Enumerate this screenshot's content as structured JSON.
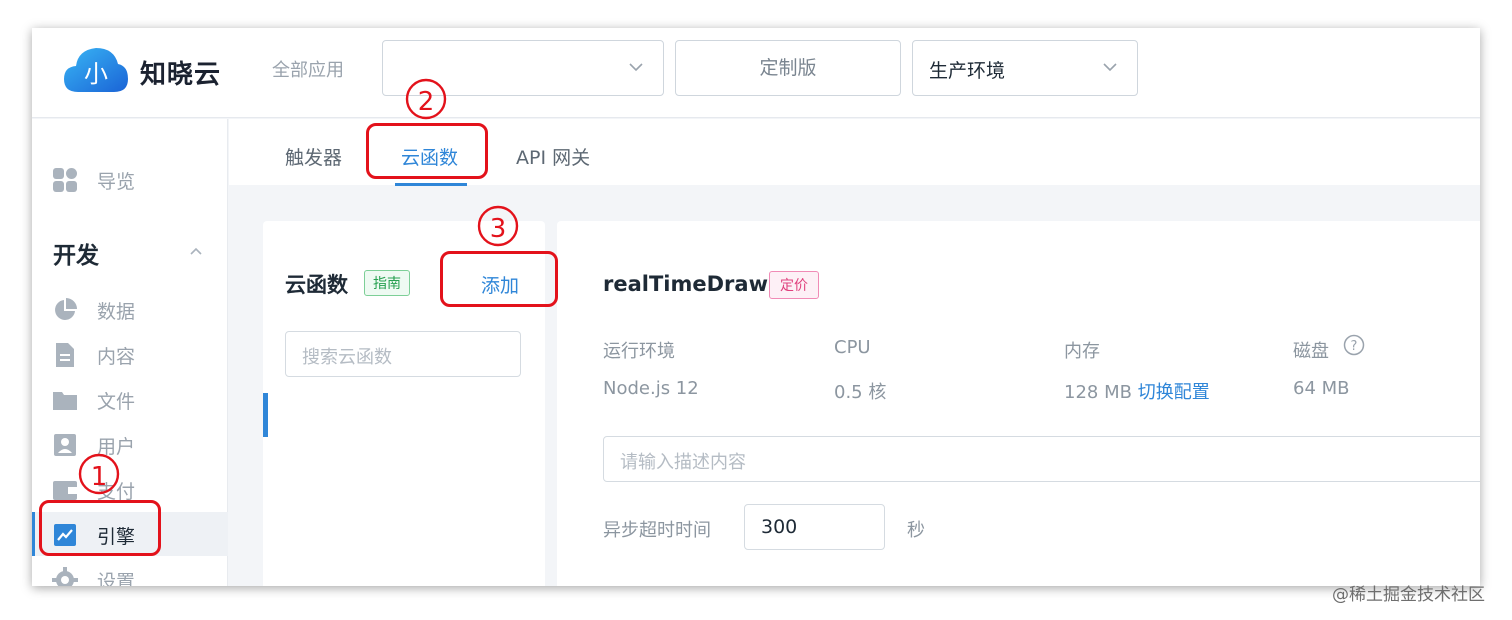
{
  "brand": {
    "name": "知晓云",
    "logo_glyph": "小"
  },
  "topbar": {
    "all_apps_label": "全部应用",
    "app_select_value": "",
    "edition_label": "定制版",
    "env_select_value": "生产环境"
  },
  "sidebar": {
    "overview": "导览",
    "section_title": "开发",
    "items": [
      "数据",
      "内容",
      "文件",
      "用户",
      "支付",
      "引擎",
      "设置"
    ],
    "active_item": "引擎"
  },
  "tabs": [
    "触发器",
    "云函数",
    "API 网关"
  ],
  "active_tab": "云函数",
  "function_list": {
    "title": "云函数",
    "guide_tag": "指南",
    "add_label": "添加",
    "search_placeholder": "搜索云函数"
  },
  "function_detail": {
    "name": "realTimeDraw",
    "price_tag": "定价",
    "runtime_label": "运行环境",
    "runtime_value": "Node.js 12",
    "cpu_label": "CPU",
    "cpu_value": "0.5 核",
    "memory_label": "内存",
    "memory_value": "128 MB",
    "memory_switch": "切换配置",
    "disk_label": "磁盘",
    "disk_value": "64 MB",
    "description_placeholder": "请输入描述内容",
    "timeout_label": "异步超时时间",
    "timeout_value": "300",
    "timeout_unit": "秒"
  },
  "annotations": {
    "n1": "1",
    "n2": "2",
    "n3": "3"
  },
  "watermark": "@稀土掘金技术社区",
  "colors": {
    "accent": "#2f86d8",
    "annotation": "#e3121b",
    "guide_tag": "#27a050",
    "price_tag": "#e0407d"
  }
}
